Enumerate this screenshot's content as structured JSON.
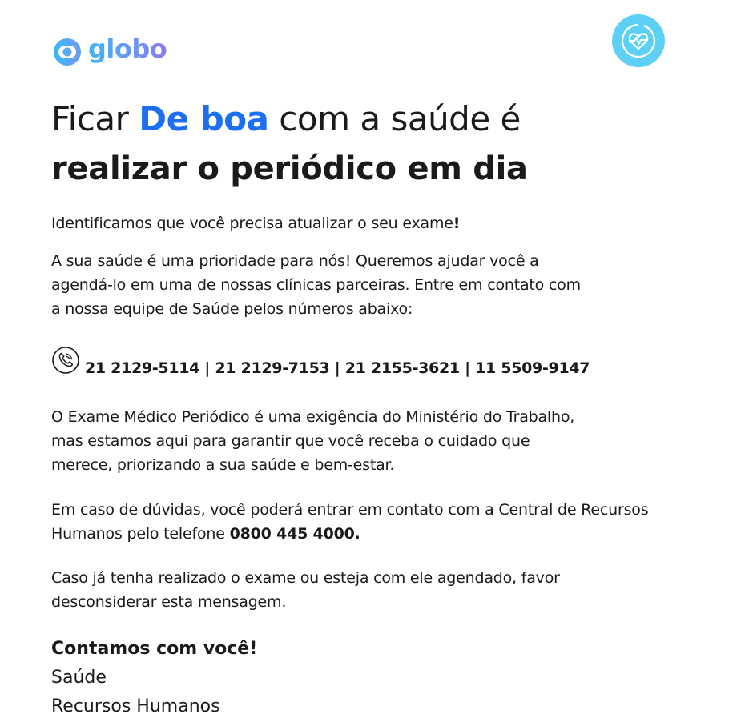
{
  "brand": {
    "name": "globo",
    "logo_icon": "globo-logo-icon",
    "badge_icon": "heart-pulse-icon",
    "colors": {
      "logo_start": "#40b6f0",
      "logo_end": "#8b7bf2",
      "badge": "#5fd0f5",
      "accent": "#1d6ff2"
    }
  },
  "headline": {
    "line1_prefix": "Ficar ",
    "line1_accent": "De boa",
    "line1_suffix": " com a saúde é",
    "line2": "realizar o periódico em dia"
  },
  "body": {
    "intro": "Identificamos que você precisa atualizar o seu exame",
    "intro_mark": "!",
    "p1_line1": "A sua saúde é uma prioridade para nós! Queremos ajudar você a",
    "p1_line2": "agendá-lo em uma de nossas clínicas parceiras. Entre em contato com",
    "p1_line3": "a nossa equipe de Saúde pelos números abaixo:",
    "phones_icon": "phone-icon",
    "phones": "21 2129-5114 | 21 2129-7153 | 21 2155-3621 | 11 5509-9147",
    "p2_line1": "O Exame Médico Periódico é uma exigência do Ministério do Trabalho,",
    "p2_line2": "mas estamos aqui para garantir que você receba o cuidado que",
    "p2_line3": "merece, priorizando a sua saúde e bem-estar.",
    "p3_line1": "Em caso de dúvidas, você poderá entrar em contato com a Central de Recursos",
    "p3_line2_prefix": "Humanos pelo telefone ",
    "p3_phone": "0800 445 4000.",
    "p4_line1": "Caso já tenha realizado o exame ou esteja com ele agendado, favor",
    "p4_line2": "desconsiderar esta mensagem."
  },
  "signature": {
    "closing": "Contamos com você!",
    "line1": "Saúde",
    "line2": "Recursos Humanos"
  }
}
